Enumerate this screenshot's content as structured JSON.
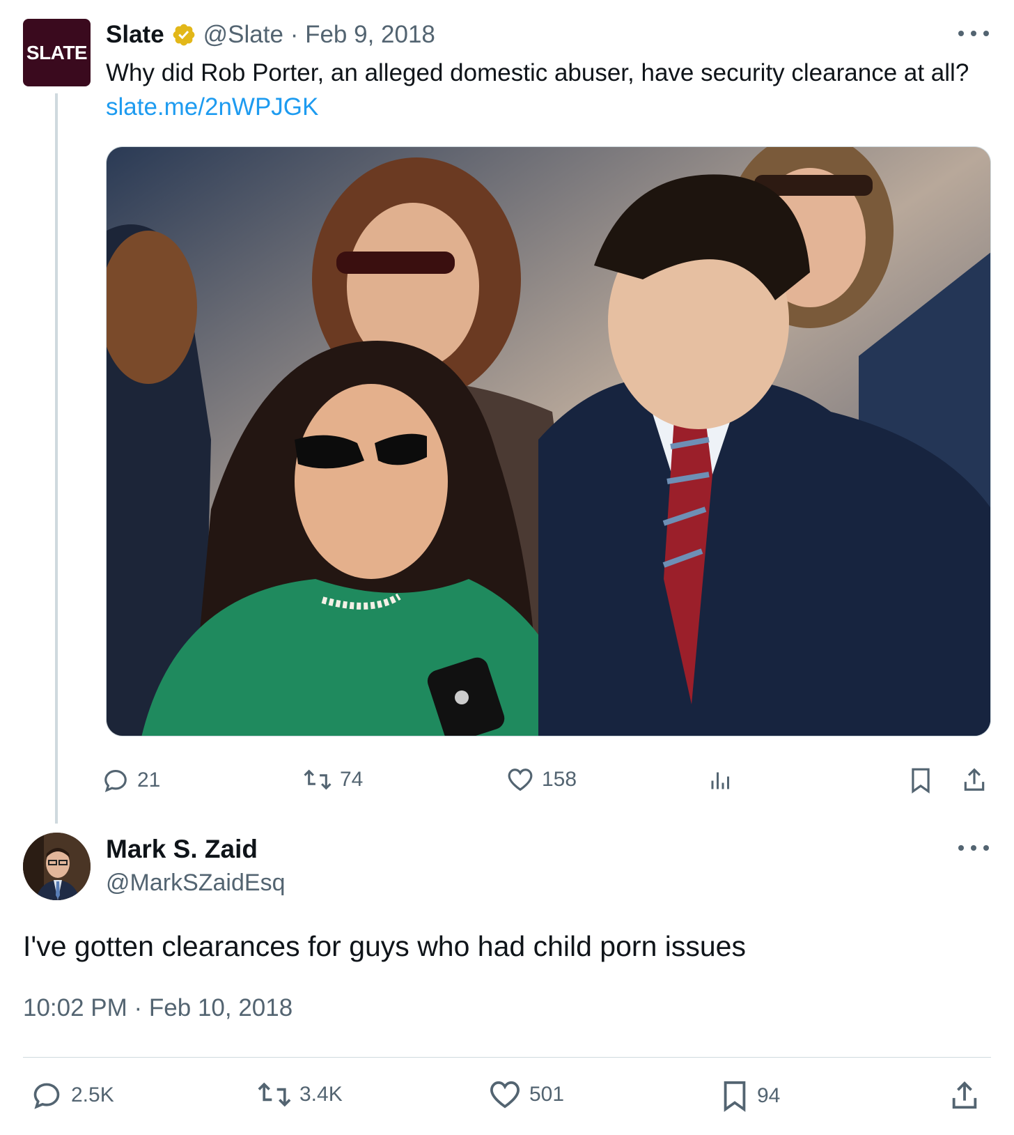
{
  "parent_tweet": {
    "avatar_text": "SLATE",
    "name": "Slate",
    "handle": "@Slate",
    "separator": " · ",
    "date": "Feb 9, 2018",
    "text": "Why did Rob Porter, an alleged domestic abuser, have security clearance at all? ",
    "link": "slate.me/2nWPJGK",
    "actions": {
      "replies": "21",
      "retweets": "74",
      "likes": "158"
    }
  },
  "reply_tweet": {
    "name": "Mark S. Zaid",
    "handle": "@MarkSZaidEsq",
    "text": "I've gotten clearances for guys who had child porn issues",
    "timestamp": "10:02 PM · Feb 10, 2018",
    "actions": {
      "replies": "2.5K",
      "retweets": "3.4K",
      "likes": "501",
      "bookmarks": "94"
    }
  },
  "colors": {
    "text": "#0f1419",
    "muted": "#536471",
    "link": "#1d9bf0",
    "verified": "#e2b719",
    "slate_brand": "#3a0a1e"
  },
  "icons": [
    "verified-badge-icon",
    "more-icon",
    "reply-icon",
    "retweet-icon",
    "like-icon",
    "views-icon",
    "bookmark-icon",
    "share-icon"
  ]
}
